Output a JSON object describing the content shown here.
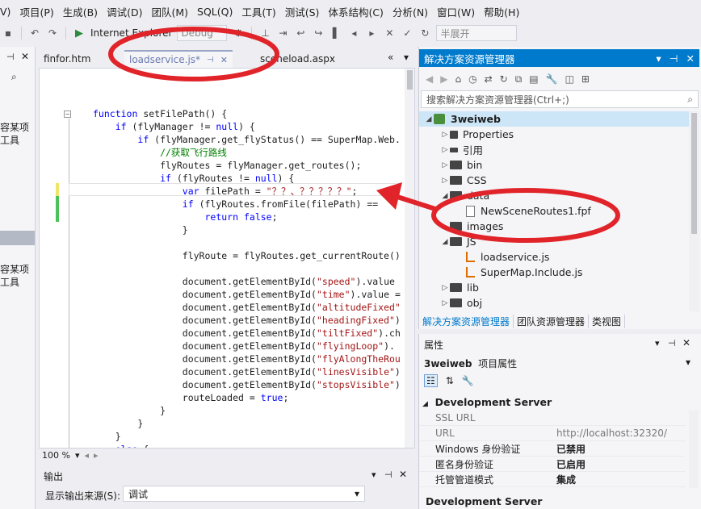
{
  "menu": [
    "V)",
    "项目(P)",
    "生成(B)",
    "调试(D)",
    "团队(M)",
    "SQL(Q)",
    "工具(T)",
    "测试(S)",
    "体系结构(C)",
    "分析(N)",
    "窗口(W)",
    "帮助(H)"
  ],
  "toolbar": {
    "run_target": "Internet Explorer",
    "config": "Debug",
    "fold_combo": "半展开"
  },
  "left_panel": {
    "lines_a": [
      "容某项",
      "工具"
    ],
    "lines_b": [
      "容某项",
      "工具"
    ]
  },
  "editor_tabs": [
    {
      "label": "finfor.htm",
      "active": false
    },
    {
      "label": "loadservice.js*",
      "active": true
    },
    {
      "label": "sceneload.aspx",
      "active": false
    }
  ],
  "code": [
    "function setFilePath() {",
    "    if (flyManager != null) {",
    "        if (flyManager.get_flyStatus() == SuperMap.Web.",
    "            //获取飞行路线",
    "            flyRoutes = flyManager.get_routes();",
    "            if (flyRoutes != null) {",
    "                var filePath = \"？？、？？？？？\";",
    "                if (flyRoutes.fromFile(filePath) ==",
    "                    return false;",
    "                }",
    "",
    "                flyRoute = flyRoutes.get_currentRoute()",
    "",
    "                document.getElementById(\"speed\").value",
    "                document.getElementById(\"time\").value =",
    "                document.getElementById(\"altitudeFixed\"",
    "                document.getElementById(\"headingFixed\")",
    "                document.getElementById(\"tiltFixed\").ch",
    "                document.getElementById(\"flyingLoop\").",
    "                document.getElementById(\"flyAlongTheRou",
    "                document.getElementById(\"linesVisible\")",
    "                document.getElementById(\"stopsVisible\")",
    "                routeLoaded = true;",
    "            }",
    "        }",
    "    }",
    "    else {"
  ],
  "editor_status": {
    "zoom": "100 %"
  },
  "output": {
    "title": "输出",
    "source_label": "显示输出来源(S):",
    "source_value": "调试"
  },
  "solution_explorer": {
    "title": "解决方案资源管理器",
    "search_placeholder": "搜索解决方案资源管理器(Ctrl+;)",
    "tree": [
      {
        "label": "3weiweb",
        "level": 0,
        "type": "project",
        "expanded": true
      },
      {
        "label": "Properties",
        "level": 1,
        "type": "props",
        "expanded": false
      },
      {
        "label": "引用",
        "level": 1,
        "type": "ref",
        "expanded": false
      },
      {
        "label": "bin",
        "level": 1,
        "type": "folder",
        "expanded": false
      },
      {
        "label": "CSS",
        "level": 1,
        "type": "folder",
        "expanded": false
      },
      {
        "label": "data",
        "level": 1,
        "type": "folder",
        "expanded": true
      },
      {
        "label": "NewSceneRoutes1.fpf",
        "level": 2,
        "type": "file",
        "expanded": null
      },
      {
        "label": "images",
        "level": 1,
        "type": "folder",
        "expanded": false
      },
      {
        "label": "JS",
        "level": 1,
        "type": "folder",
        "expanded": true
      },
      {
        "label": "loadservice.js",
        "level": 2,
        "type": "js",
        "expanded": null
      },
      {
        "label": "SuperMap.Include.js",
        "level": 2,
        "type": "js",
        "expanded": null
      },
      {
        "label": "lib",
        "level": 1,
        "type": "folder",
        "expanded": false
      },
      {
        "label": "obj",
        "level": 1,
        "type": "folder",
        "expanded": false
      }
    ],
    "tabs": [
      "解决方案资源管理器",
      "团队资源管理器",
      "类视图"
    ]
  },
  "properties": {
    "title": "属性",
    "object_name": "3weiweb",
    "object_type": "项目属性",
    "category": "Development Server",
    "rows": [
      {
        "name": "SSL URL",
        "value": "",
        "dim": true
      },
      {
        "name": "URL",
        "value": "http://localhost:32320/",
        "dim": true
      },
      {
        "name": "Windows 身份验证",
        "value": "已禁用",
        "dim": false
      },
      {
        "name": "匿名身份验证",
        "value": "已启用",
        "dim": false
      },
      {
        "name": "托管管道模式",
        "value": "集成",
        "dim": false
      }
    ],
    "footer": "Development Server"
  },
  "colors": {
    "annotation_red": "#e0242a",
    "title_blue": "#007acc"
  }
}
